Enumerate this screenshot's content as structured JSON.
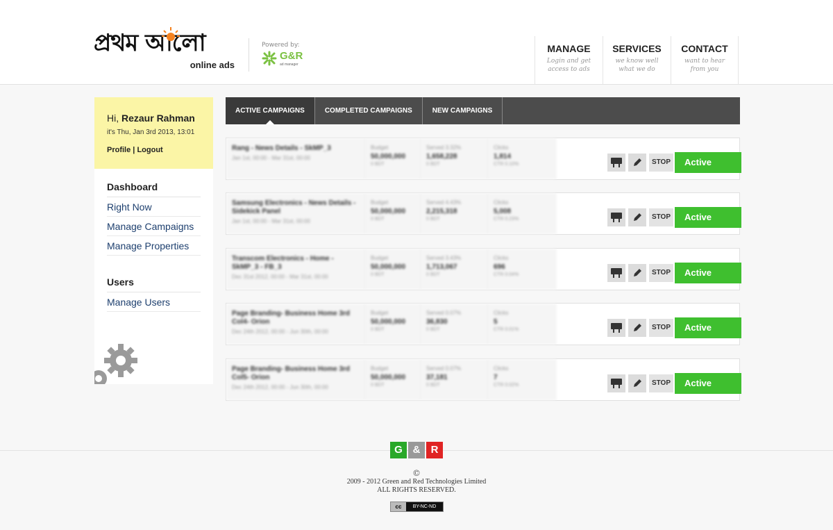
{
  "header": {
    "logo_bn": "প্রথম আলো",
    "logo_sub": "online ads",
    "powered_label": "Powered by:",
    "partner_logo": "G&R",
    "partner_sub": "ad manager",
    "nav": [
      {
        "title": "MANAGE",
        "sub": "Login and get access to ads"
      },
      {
        "title": "SERVICES",
        "sub": "we know well what we do"
      },
      {
        "title": "CONTACT",
        "sub": "want to hear from you"
      }
    ]
  },
  "user": {
    "greeting": "Hi, ",
    "name": "Rezaur Rahman",
    "date": "it's Thu, Jan 3rd 2013, 13:01",
    "profile": "Profile",
    "sep": " | ",
    "logout": "Logout"
  },
  "sidebar": {
    "dashboard_head": "Dashboard",
    "items": [
      "Right Now",
      "Manage Campaigns",
      "Manage Properties"
    ],
    "users_head": "Users",
    "user_items": [
      "Manage Users"
    ]
  },
  "tabs": [
    "ACTIVE CAMPAIGNS",
    "COMPLETED CAMPAIGNS",
    "NEW CAMPAIGNS"
  ],
  "campaigns": [
    {
      "name": "Rang - News Details - SkMP_3",
      "dates": "Jan 1st, 00:00 - Mar 31st, 00:00",
      "budget": "50,000,000",
      "budget_sub": "0 BDT",
      "served_label": "Served 3.32%",
      "served": "1,658,228",
      "served_sub": "0 BDT",
      "clicks": "1,814",
      "ctr": "CTR 0.10%",
      "stop": "STOP",
      "status": "Active"
    },
    {
      "name": "Samsung Electronics - News Details - Sidekick Panel",
      "dates": "Jan 1st, 00:00 - Mar 31st, 00:00",
      "budget": "50,000,000",
      "budget_sub": "0 BDT",
      "served_label": "Served 4.43%",
      "served": "2,215,318",
      "served_sub": "0 BDT",
      "clicks": "5,008",
      "ctr": "CTR 0.23%",
      "stop": "STOP",
      "status": "Active"
    },
    {
      "name": "Transcom Electronics - Home - SkMP_3 - FB_3",
      "dates": "Dec 31st 2012, 00:00 - Mar 31st, 00:00",
      "budget": "50,000,000",
      "budget_sub": "0 BDT",
      "served_label": "Served 3.43%",
      "served": "1,713,067",
      "served_sub": "0 BDT",
      "clicks": "696",
      "ctr": "CTR 0.04%",
      "stop": "STOP",
      "status": "Active"
    },
    {
      "name": "Page Branding- Business Home 3rd Col4- Orion",
      "dates": "Dec 24th 2012, 00:00 - Jun 30th, 00:00",
      "budget": "50,000,000",
      "budget_sub": "0 BDT",
      "served_label": "Served 0.07%",
      "served": "36,830",
      "served_sub": "0 BDT",
      "clicks": "5",
      "ctr": "CTR 0.01%",
      "stop": "STOP",
      "status": "Active"
    },
    {
      "name": "Page Branding- Business Home 3rd Col5- Orion",
      "dates": "Dec 24th 2012, 00:00 - Jun 30th, 00:00",
      "budget": "50,000,000",
      "budget_sub": "0 BDT",
      "served_label": "Served 0.07%",
      "served": "37,181",
      "served_sub": "0 BDT",
      "clicks": "7",
      "ctr": "CTR 0.02%",
      "stop": "STOP",
      "status": "Active"
    }
  ],
  "labels": {
    "budget": "Budget",
    "clicks": "Clicks"
  },
  "footer": {
    "logo": [
      "G",
      "&",
      "R"
    ],
    "copy_symbol": "©",
    "line1": "2009 - 2012 Green and Red Technologies Limited",
    "line2": "ALL RIGHTS RESERVED.",
    "cc_label": "cc",
    "cc_text": "BY-NC-ND"
  },
  "colors": {
    "accent_green": "#3fbf2f",
    "user_box": "#fbf5a6",
    "tab_bar": "#4c4c4c"
  }
}
